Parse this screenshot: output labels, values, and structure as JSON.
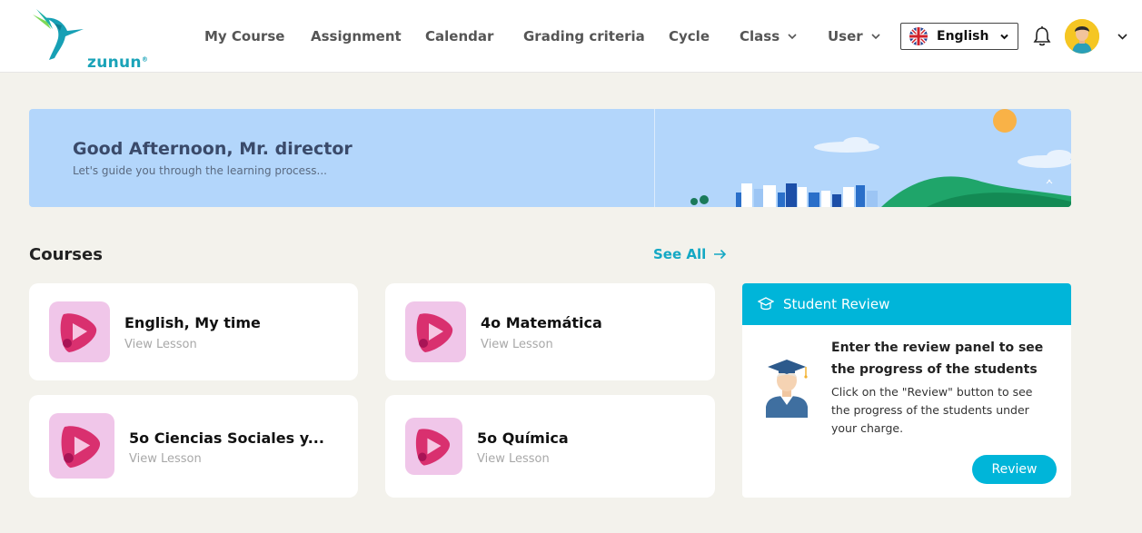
{
  "brand": {
    "name": "zunun",
    "mark": "®"
  },
  "nav": {
    "my_course": "My Course",
    "assignment": "Assignment",
    "calendar": "Calendar",
    "grading": "Grading criteria",
    "cycle": "Cycle",
    "class": "Class",
    "user": "User"
  },
  "language": {
    "selected": "English"
  },
  "icons": {
    "logo": "hummingbird-logo",
    "flag": "uk-flag-icon",
    "bell": "bell-icon",
    "avatar": "user-avatar",
    "dropdown": "chevron-down-icon",
    "see_all": "arrow-right-icon",
    "review_head": "graduation-cap-icon",
    "review_illustration": "graduate-illustration"
  },
  "colors": {
    "accent": "#00b5d9",
    "banner": "#b3d6fb",
    "background": "#f3f2ec"
  },
  "banner": {
    "greeting": "Good Afternoon, Mr. director",
    "subtitle": "Let's guide you through the learning process..."
  },
  "courses": {
    "title": "Courses",
    "see_all": "See All",
    "items": [
      {
        "title": "English, My time",
        "sub": "View Lesson"
      },
      {
        "title": "4o Matemática",
        "sub": "View Lesson"
      },
      {
        "title": "5o Ciencias Sociales y...",
        "sub": "View Lesson"
      },
      {
        "title": "5o Química",
        "sub": "View Lesson"
      }
    ]
  },
  "review": {
    "header": "Student Review",
    "title": "Enter the review panel to see the progress of the students",
    "text": "Click on the \"Review\" button to see the progress of the students under your charge.",
    "button": "Review"
  }
}
